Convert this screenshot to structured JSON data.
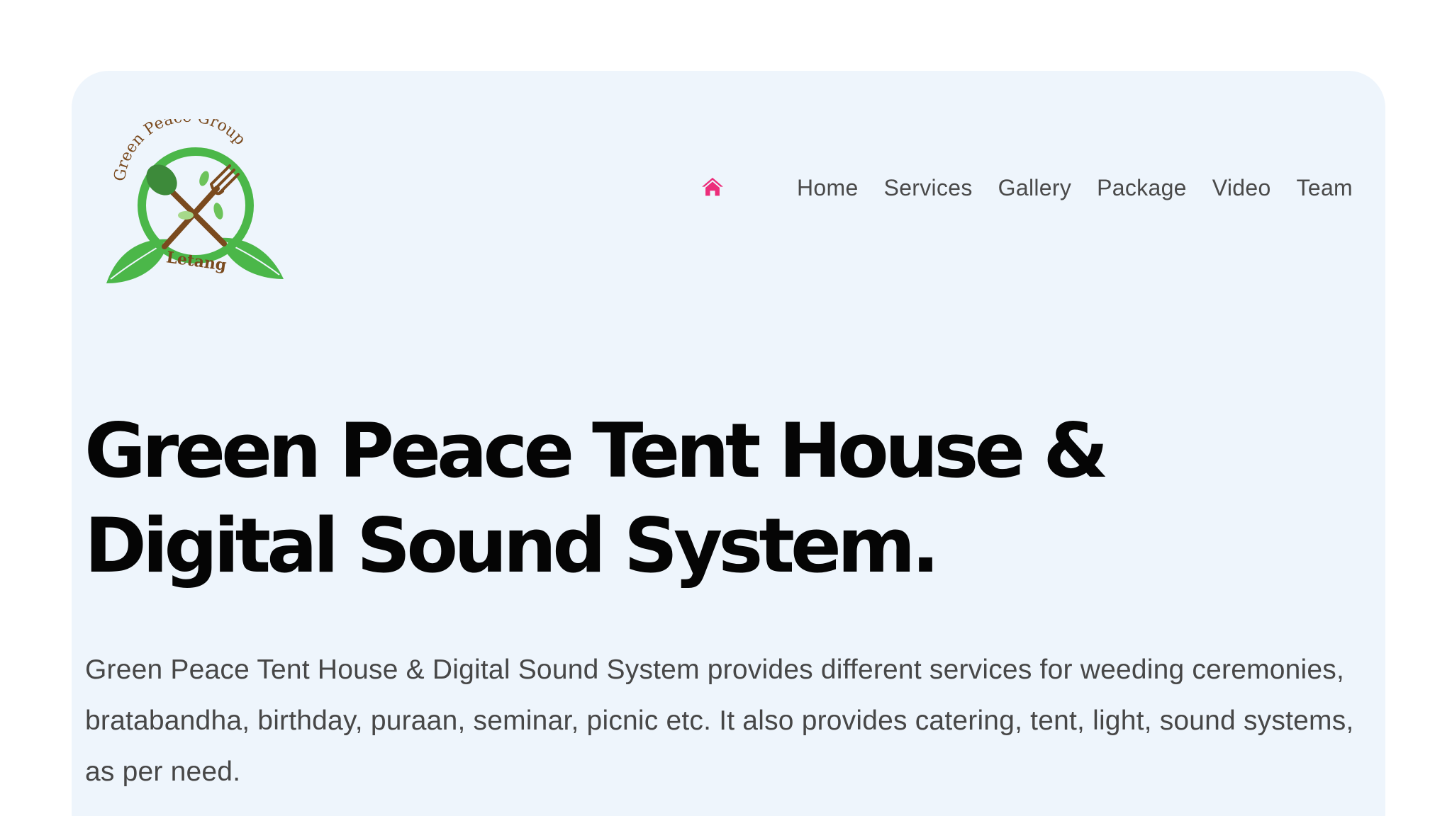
{
  "logo": {
    "arc_text": "Green Peace Group",
    "bottom_text": "Letang"
  },
  "nav": {
    "home_icon": "home-icon",
    "items": [
      {
        "label": "Home"
      },
      {
        "label": "Services"
      },
      {
        "label": "Gallery"
      },
      {
        "label": "Package"
      },
      {
        "label": "Video"
      },
      {
        "label": "Team"
      }
    ]
  },
  "hero": {
    "title": "Green Peace Tent House & Digital Sound System.",
    "description": "Green Peace Tent House & Digital Sound System provides different services for weeding ceremonies, bratabandha, birthday, puraan, seminar, picnic etc. It also provides catering, tent, light, sound systems, as per need."
  },
  "colors": {
    "card_background": "#eef5fc",
    "accent_pink": "#ec2d7a",
    "logo_green": "#4bb749",
    "logo_brown": "#7a4a1e",
    "heading": "#050505",
    "body_text": "#474747"
  }
}
